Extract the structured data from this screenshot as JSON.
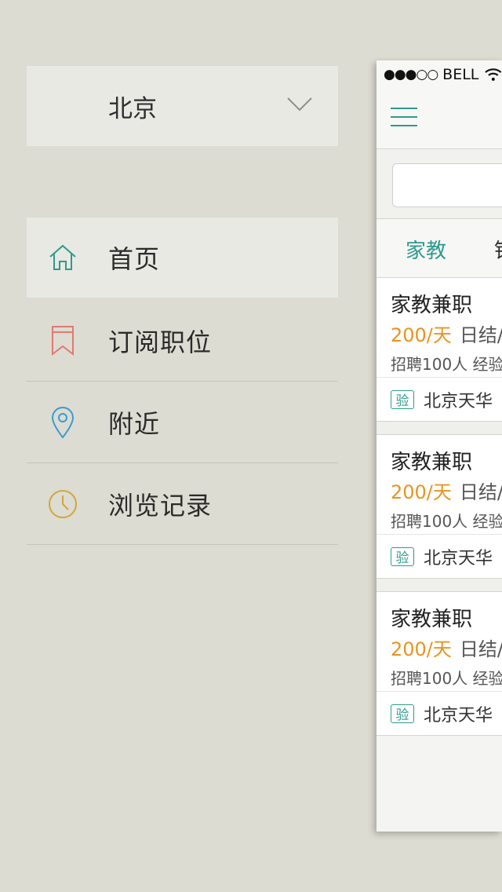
{
  "drawer": {
    "city": "北京",
    "menu": [
      {
        "label": "首页",
        "icon": "home-icon",
        "color": "#2e9a8c"
      },
      {
        "label": "订阅职位",
        "icon": "bookmark-icon",
        "color": "#e07a72"
      },
      {
        "label": "附近",
        "icon": "location-pin-icon",
        "color": "#3b9bd1"
      },
      {
        "label": "浏览记录",
        "icon": "clock-icon",
        "color": "#d2a63a"
      }
    ]
  },
  "phone": {
    "status": {
      "signal": "●●●○○",
      "carrier": "BELL"
    },
    "tabs": [
      "家教",
      "销"
    ],
    "cards": [
      {
        "title": "家教兼职",
        "price": "200/天",
        "settle": "日结/",
        "req": "招聘100人 经验",
        "badge": "验",
        "company": "北京天华"
      },
      {
        "title": "家教兼职",
        "price": "200/天",
        "settle": "日结/",
        "req": "招聘100人 经验",
        "badge": "验",
        "company": "北京天华"
      },
      {
        "title": "家教兼职",
        "price": "200/天",
        "settle": "日结/",
        "req": "招聘100人 经验",
        "badge": "验",
        "company": "北京天华"
      }
    ]
  },
  "colors": {
    "accent": "#2e9a8c",
    "price": "#e8941f",
    "background": "#dcdcd2"
  }
}
